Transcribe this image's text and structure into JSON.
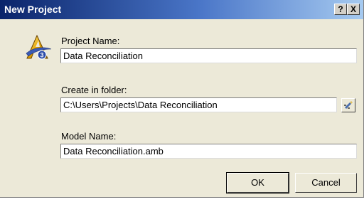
{
  "window": {
    "title": "New Project",
    "help_label": "?",
    "close_label": "X"
  },
  "app_icon": {
    "name": "a3-app-icon",
    "badge": "3"
  },
  "project_name": {
    "label": "Project Name:",
    "value": "Data Reconciliation"
  },
  "folder": {
    "label": "Create in folder:",
    "value": "C:\\Users\\Projects\\Data Reconciliation",
    "browse_icon": "folder-browse-icon"
  },
  "model_name": {
    "label": "Model Name:",
    "value": "Data Reconciliation.amb"
  },
  "buttons": {
    "ok": "OK",
    "cancel": "Cancel"
  },
  "colors": {
    "title_gradient_start": "#0a246a",
    "title_gradient_end": "#a6caf0",
    "dialog_bg": "#ece9d8"
  }
}
